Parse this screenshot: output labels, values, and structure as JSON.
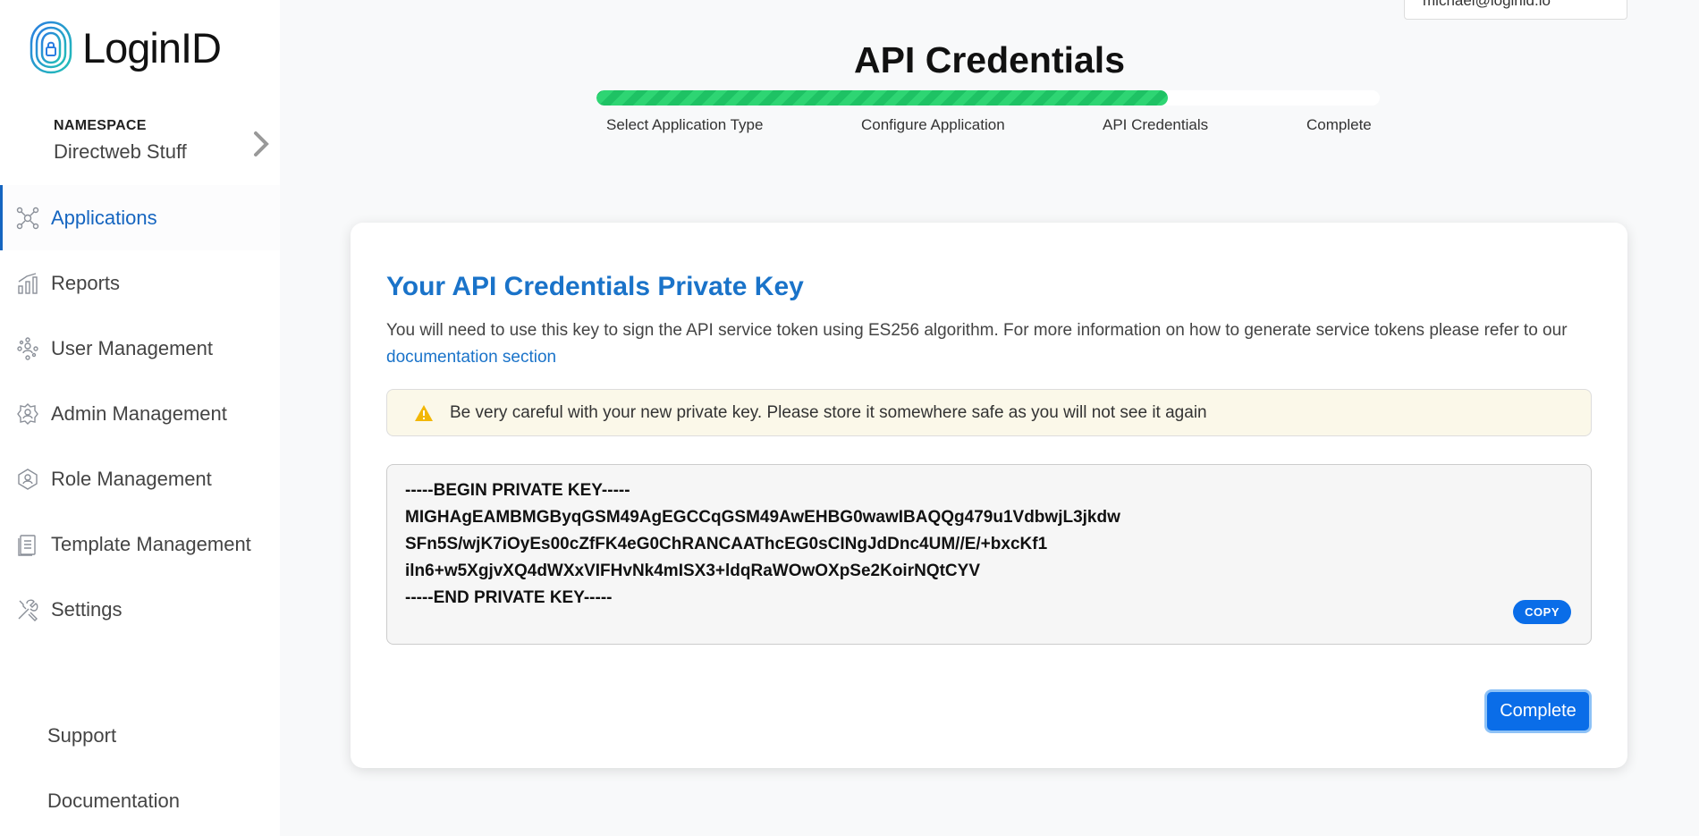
{
  "brand": {
    "name": "LoginID"
  },
  "namespace": {
    "label": "NAMESPACE",
    "value": "Directweb Stuff"
  },
  "sidebar": {
    "items": [
      {
        "label": "Applications",
        "icon": "applications-icon",
        "active": true
      },
      {
        "label": "Reports",
        "icon": "reports-icon",
        "active": false
      },
      {
        "label": "User Management",
        "icon": "user-management-icon",
        "active": false
      },
      {
        "label": "Admin Management",
        "icon": "admin-management-icon",
        "active": false
      },
      {
        "label": "Role Management",
        "icon": "role-management-icon",
        "active": false
      },
      {
        "label": "Template Management",
        "icon": "template-management-icon",
        "active": false
      },
      {
        "label": "Settings",
        "icon": "settings-icon",
        "active": false
      }
    ],
    "footer": [
      {
        "label": "Support"
      },
      {
        "label": "Documentation"
      }
    ]
  },
  "user_menu": {
    "label": "michael@loginid.io"
  },
  "wizard": {
    "title": "API Credentials",
    "progress": 0.73,
    "steps": [
      {
        "label": "Select Application Type"
      },
      {
        "label": "Configure Application"
      },
      {
        "label": "API Credentials"
      },
      {
        "label": "Complete"
      }
    ]
  },
  "card": {
    "title": "Your API Credentials Private Key",
    "description": "You will need to use this key to sign the API service token using ES256 algorithm. For more information on how to generate service tokens please refer to our ",
    "doc_link": "documentation section",
    "alert": "Be very careful with your new private key. Please store it somewhere safe as you will not see it again",
    "key_lines": [
      "-----BEGIN PRIVATE KEY-----",
      "MIGHAgEAMBMGByqGSM49AgEGCCqGSM49AwEHBG0wawIBAQQg479u1VdbwjL3jkdw",
      "SFn5S/wjK7iOyEs00cZfFK4eG0ChRANCAAThcEG0sCINgJdDnc4UM//E/+bxcKf1",
      "iln6+w5XgjvXQ4dWXxVIFHvNk4mISX3+ldqRaWOwOXpSe2KoirNQtCYV",
      "-----END PRIVATE KEY-----"
    ],
    "copy_label": "COPY",
    "complete_label": "Complete"
  },
  "colors": {
    "accent": "#0a6de8",
    "link": "#1a73c9",
    "progress": "#2ed573",
    "alert_bg": "#fbf8e9"
  }
}
